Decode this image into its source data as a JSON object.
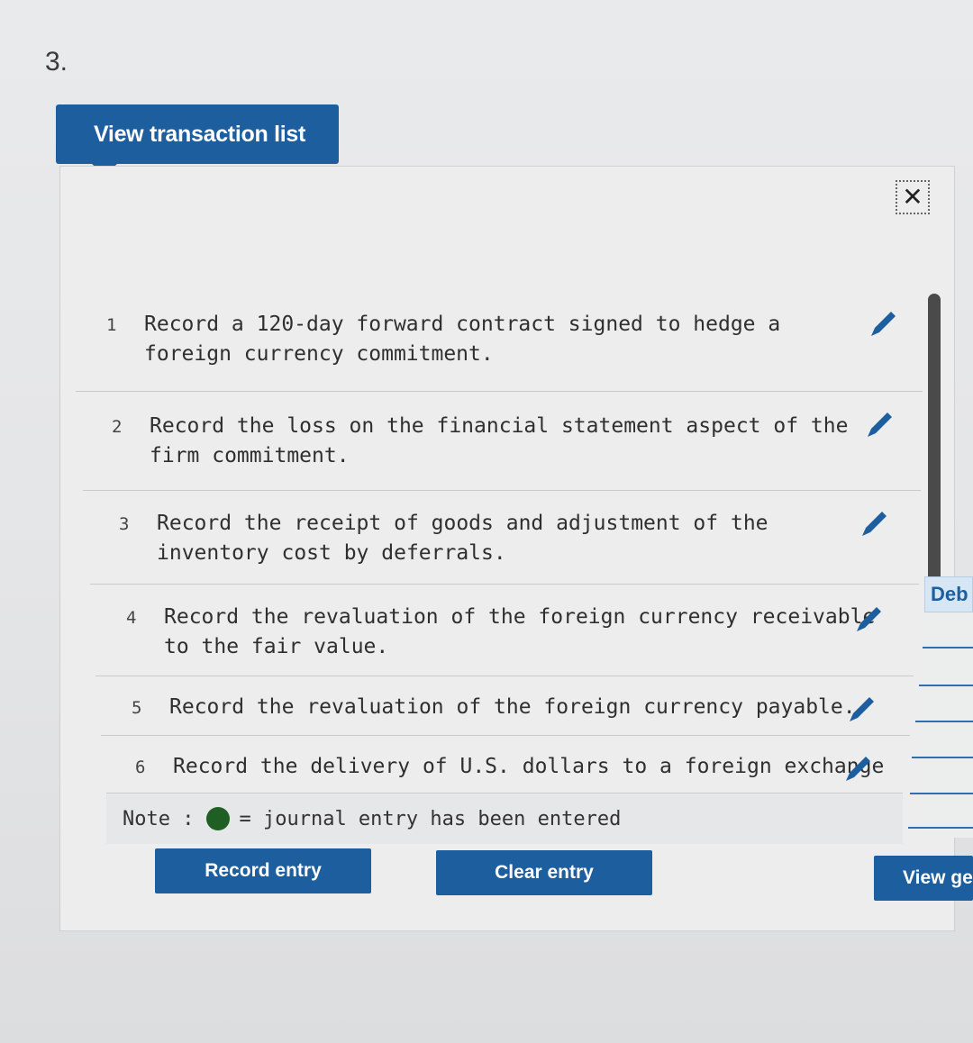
{
  "question_number": "3.",
  "transaction_list_button": "View transaction list",
  "close_symbol": "✕",
  "transactions": [
    {
      "num": "1",
      "text_line1": "Record a 120-day forward contract signed to hedge a",
      "text_line2": "foreign currency commitment."
    },
    {
      "num": "2",
      "text_line1": "Record the loss on the financial statement aspect of the",
      "text_line2": "firm commitment."
    },
    {
      "num": "3",
      "text_line1": "Record the receipt of goods and adjustment of the",
      "text_line2": "inventory cost by deferrals."
    },
    {
      "num": "4",
      "text_line1": "Record the revaluation of the foreign currency receivable",
      "text_line2": "to the fair value."
    },
    {
      "num": "5",
      "text_line1": "Record the revaluation of the foreign currency payable.",
      "text_line2": ""
    },
    {
      "num": "6",
      "text_line1": "Record the delivery of U.S. dollars to a foreign exchange",
      "text_line2": ""
    }
  ],
  "note": {
    "label": "Note :",
    "text": "= journal entry has been entered",
    "dot_color": "#1f5f24"
  },
  "buttons": {
    "record": "Record entry",
    "clear": "Clear entry",
    "view_general": "View ge"
  },
  "right_pane": {
    "debit_header": "Deb"
  },
  "icons": {
    "edit": "pencil-icon",
    "close": "close-icon"
  },
  "colors": {
    "accent": "#1d5f9e",
    "pencil": "#1d5f9e"
  }
}
